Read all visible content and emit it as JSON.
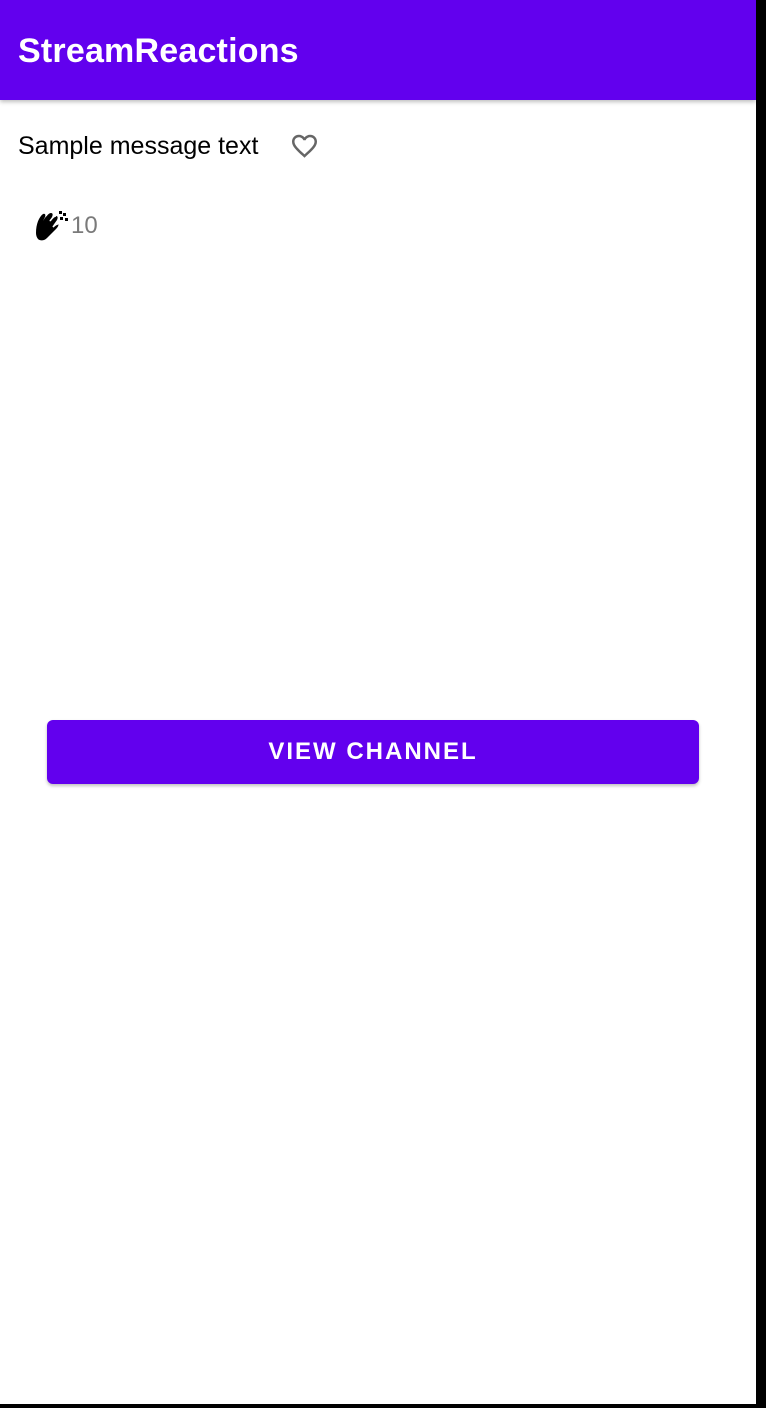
{
  "app_bar": {
    "title": "StreamReactions",
    "background_color": "#6200ee"
  },
  "message": {
    "text": "Sample message text",
    "reaction_action_icon": "heart-outline-icon"
  },
  "reactions": [
    {
      "icon": "clapping-hands-icon",
      "count": "10"
    }
  ],
  "actions": {
    "view_channel_label": "VIEW CHANNEL",
    "button_color": "#6200ee"
  }
}
